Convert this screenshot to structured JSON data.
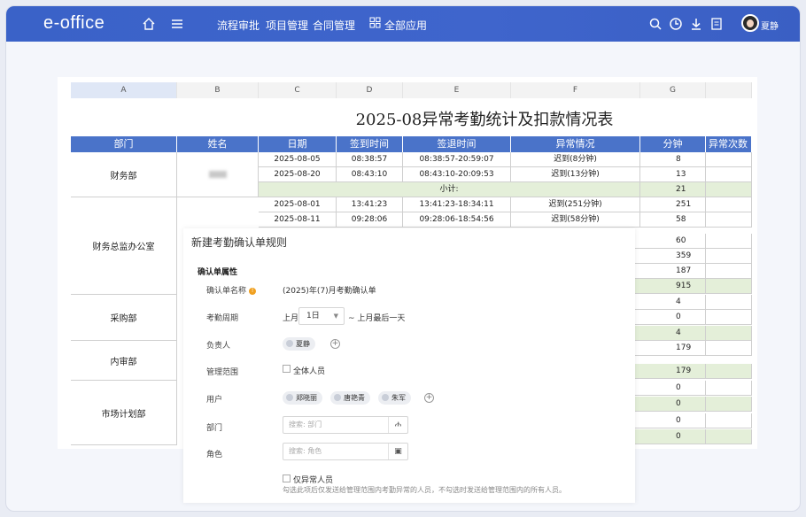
{
  "topbar": {
    "logo": "e-office",
    "nav": [
      "流程审批",
      "项目管理",
      "合同管理"
    ],
    "all_apps": "全部应用",
    "user_name": "夏静"
  },
  "sheet": {
    "columns": [
      "A",
      "B",
      "C",
      "D",
      "E",
      "F",
      "G"
    ],
    "title": "2025-08异常考勤统计及扣款情况表",
    "headers": [
      "部门",
      "姓名",
      "日期",
      "签到时间",
      "签退时间",
      "异常情况",
      "分钟",
      "异常次数"
    ],
    "rows": [
      {
        "date": "2025-08-05",
        "in": "08:38:57",
        "out": "08:38:57-20:59:07",
        "status": "迟到(8分钟)",
        "min": "8"
      },
      {
        "date": "2025-08-20",
        "in": "08:43:10",
        "out": "08:43:10-20:09:53",
        "status": "迟到(13分钟)",
        "min": "13"
      },
      {
        "subtotal": "小计:",
        "min": "21"
      },
      {
        "date": "2025-08-01",
        "in": "13:41:23",
        "out": "13:41:23-18:34:11",
        "status": "迟到(251分钟)",
        "min": "251"
      },
      {
        "date": "2025-08-11",
        "in": "09:28:06",
        "out": "09:28:06-18:54:56",
        "status": "迟到(58分钟)",
        "min": "58"
      }
    ],
    "minutes_rest": [
      "60",
      "359",
      "187",
      "915",
      "4",
      "0",
      "4",
      "179",
      "179",
      "0",
      "0",
      "0",
      "0"
    ],
    "departments": [
      "财务部",
      "财务总监办公室",
      "采购部",
      "内审部",
      "市场计划部"
    ]
  },
  "modal": {
    "title": "新建考勤确认单规则",
    "section": "确认单属性",
    "fields": {
      "name_label": "确认单名称",
      "name_value": "(2025)年(7)月考勤确认单",
      "period_label": "考勤周期",
      "period_prefix": "上月",
      "period_day": "1日",
      "period_suffix": "~ 上月最后一天",
      "owner_label": "负责人",
      "owner": "夏静",
      "scope_label": "管理范围",
      "scope_all": "全体人员",
      "users_label": "用户",
      "users": [
        "郑晓丽",
        "唐艳青",
        "朱军"
      ],
      "dept_label": "部门",
      "dept_placeholder": "搜索: 部门",
      "role_label": "角色",
      "role_placeholder": "搜索: 角色",
      "only_abnormal": "仅异常人员",
      "hint": "勾选此项后仅发送给管理范围内考勤异常的人员，不勾选时发送给管理范围内的所有人员。"
    }
  }
}
